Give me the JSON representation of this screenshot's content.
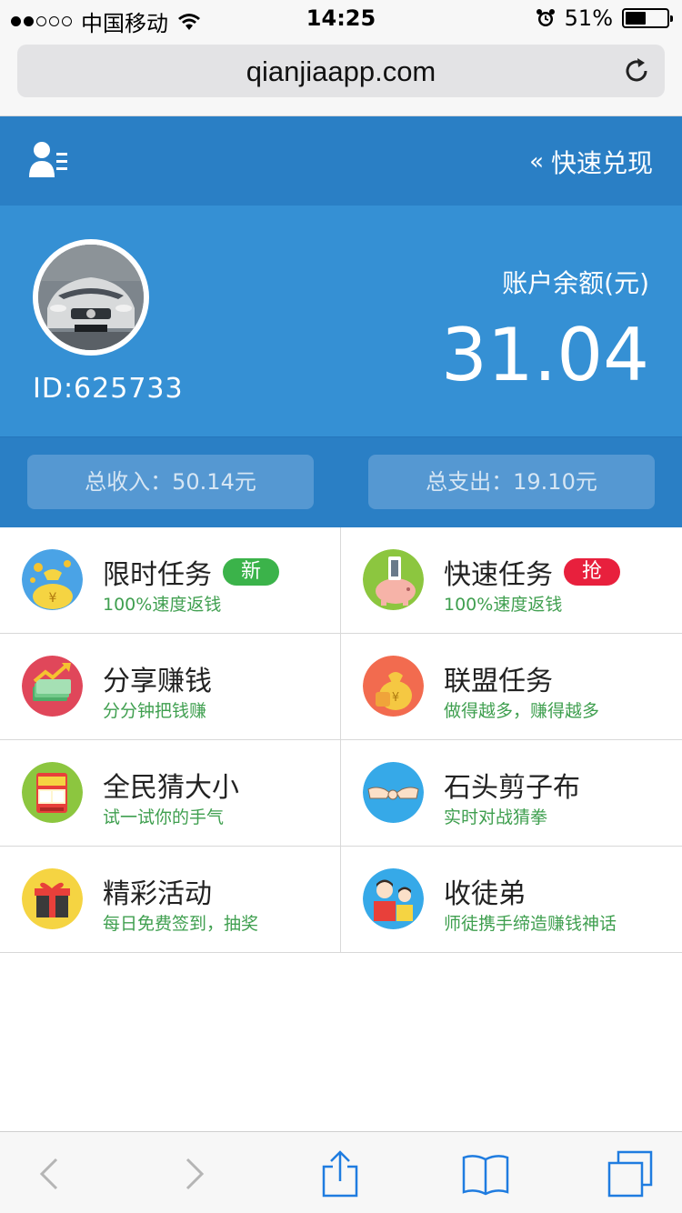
{
  "status_bar": {
    "carrier": "中国移动",
    "time": "14:25",
    "battery_text": "51%",
    "battery_level": 0.51,
    "signal_bars_filled": 2,
    "signal_bars_total": 5
  },
  "browser": {
    "url": "qianjiaapp.com"
  },
  "header": {
    "quick_cash_label": "快速兑现",
    "quick_cash_chevron": "«"
  },
  "profile": {
    "user_id": "ID:625733",
    "balance_label": "账户余额(元)",
    "balance_value": "31.04"
  },
  "stats": {
    "income": "总收入：50.14元",
    "expense": "总支出：19.10元"
  },
  "features": [
    {
      "title": "限时任务",
      "subtitle": "100%速度返钱",
      "badge": "新",
      "badge_color": "#3bb34a",
      "icon": "money-bag-icon"
    },
    {
      "title": "快速任务",
      "subtitle": "100%速度返钱",
      "badge": "抢",
      "badge_color": "#e8203d",
      "icon": "piggy-bank-icon"
    },
    {
      "title": "分享赚钱",
      "subtitle": "分分钟把钱赚",
      "badge": "",
      "icon": "cash-growth-icon"
    },
    {
      "title": "联盟任务",
      "subtitle": "做得越多，赚得越多",
      "badge": "",
      "icon": "coin-bag-icon"
    },
    {
      "title": "全民猜大小",
      "subtitle": "试一试你的手气",
      "badge": "",
      "icon": "slot-machine-icon"
    },
    {
      "title": "石头剪子布",
      "subtitle": "实时对战猜拳",
      "badge": "",
      "icon": "rock-paper-scissors-icon"
    },
    {
      "title": "精彩活动",
      "subtitle": "每日免费签到，抽奖",
      "badge": "",
      "icon": "gift-box-icon"
    },
    {
      "title": "收徒弟",
      "subtitle": "师徒携手缔造赚钱神话",
      "badge": "",
      "icon": "master-apprentice-icon"
    }
  ],
  "colors": {
    "header_bg": "#2a7fc5",
    "profile_bg": "#3590d4",
    "subtitle_green": "#3f9f4f",
    "badge_green": "#3bb34a",
    "badge_red": "#e8203d"
  }
}
